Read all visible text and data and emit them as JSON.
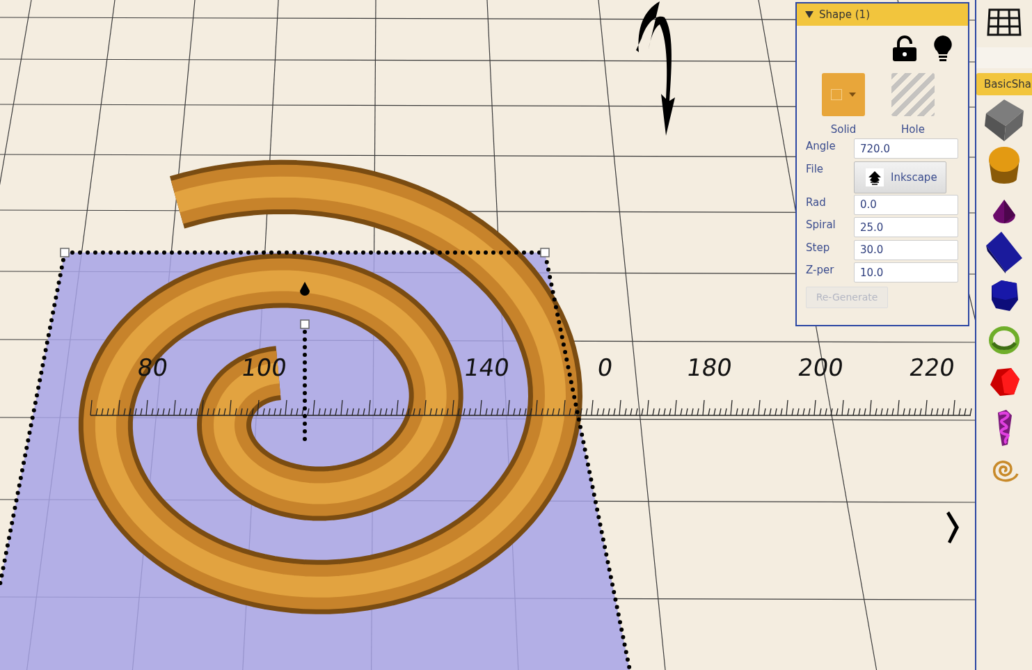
{
  "viewport": {
    "ruler_labels": [
      "80",
      "100",
      "140",
      "0",
      "180",
      "200",
      "220"
    ]
  },
  "panel": {
    "title": "Shape (1)",
    "expanded": true,
    "locked": false,
    "modes": [
      {
        "label": "Solid",
        "kind": "solid"
      },
      {
        "label": "Hole",
        "kind": "hole"
      }
    ],
    "params": [
      {
        "kind": "field",
        "label": "Angle",
        "value": "720.0"
      },
      {
        "kind": "file",
        "label": "File",
        "button": "Inkscape"
      },
      {
        "kind": "field",
        "label": "Rad",
        "value": "0.0"
      },
      {
        "kind": "field",
        "label": "Spiral",
        "value": "25.0"
      },
      {
        "kind": "field",
        "label": "Step",
        "value": "30.0"
      },
      {
        "kind": "field",
        "label": "Z-per",
        "value": "10.0"
      }
    ],
    "action": {
      "label": "Re-Generate",
      "disabled": true
    }
  },
  "sidebar": {
    "tab": "BasicSha"
  }
}
